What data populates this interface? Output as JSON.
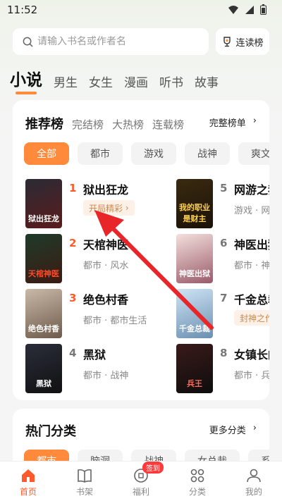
{
  "status": {
    "time": "11:52"
  },
  "search": {
    "placeholder": "请输入书名或作者名",
    "icon": "search-icon"
  },
  "read_rank": {
    "label": "连读榜",
    "icon": "trophy-icon"
  },
  "categories": [
    "小说",
    "男生",
    "女生",
    "漫画",
    "听书",
    "故事"
  ],
  "rank_section": {
    "title": "推荐榜",
    "tabs": [
      "完结榜",
      "大热榜",
      "连载榜"
    ],
    "full_list_label": "完整榜单",
    "genres": [
      "全部",
      "都市",
      "游戏",
      "战神",
      "爽文"
    ],
    "books": [
      {
        "rank": "1",
        "title": "狱出狂龙",
        "tag": "开局精彩",
        "cover_text": "狱出狂龙"
      },
      {
        "rank": "2",
        "title": "天棺神医",
        "meta": "都市 · 风水",
        "cover_text": "天棺神医"
      },
      {
        "rank": "3",
        "title": "绝色村香",
        "meta": "都市 · 都市生活",
        "cover_text": "绝色村香"
      },
      {
        "rank": "4",
        "title": "黑狱",
        "meta": "都市 · 战神",
        "cover_text": "黑狱"
      },
      {
        "rank": "5",
        "title": "网游之我的职业是财主",
        "meta": "游戏 · 网游",
        "cover_text": "我的职业是财主"
      },
      {
        "rank": "6",
        "title": "神医出狱已无敌",
        "meta": "都市 · 神医",
        "cover_text": "神医出狱"
      },
      {
        "rank": "7",
        "title": "千金总裁",
        "tag": "封神之作",
        "cover_text": "千金总裁"
      },
      {
        "rank": "8",
        "title": "女镇长的兵王",
        "meta": "都市 · 兵王",
        "cover_text": "兵王"
      }
    ]
  },
  "hot_section": {
    "title": "热门分类",
    "more_label": "更多分类",
    "pills": [
      "都市",
      "脑洞",
      "战神",
      "女总裁",
      "系统"
    ]
  },
  "bottom_nav": [
    {
      "label": "首页",
      "icon": "home-icon"
    },
    {
      "label": "书架",
      "icon": "bookshelf-icon"
    },
    {
      "label": "福利",
      "icon": "gift-icon",
      "badge": "签到"
    },
    {
      "label": "分类",
      "icon": "category-icon"
    },
    {
      "label": "我的",
      "icon": "profile-icon"
    }
  ],
  "colors": {
    "accent": "#ff8a3c",
    "rank_top": "#ff5a2c",
    "arrow": "#e8262a"
  }
}
